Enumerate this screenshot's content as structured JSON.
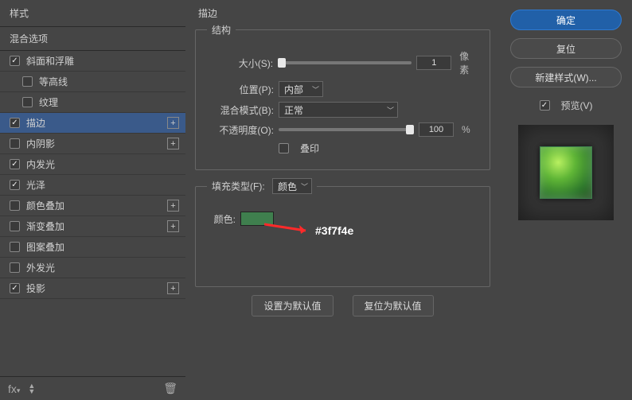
{
  "left": {
    "header": "样式",
    "subheader": "混合选项",
    "items": [
      {
        "label": "斜面和浮雕",
        "checked": true,
        "indented": false,
        "plus": false
      },
      {
        "label": "等高线",
        "checked": false,
        "indented": true,
        "plus": false
      },
      {
        "label": "纹理",
        "checked": false,
        "indented": true,
        "plus": false
      },
      {
        "label": "描边",
        "checked": true,
        "indented": false,
        "plus": true,
        "selected": true
      },
      {
        "label": "内阴影",
        "checked": false,
        "indented": false,
        "plus": true
      },
      {
        "label": "内发光",
        "checked": true,
        "indented": false,
        "plus": false
      },
      {
        "label": "光泽",
        "checked": true,
        "indented": false,
        "plus": false
      },
      {
        "label": "颜色叠加",
        "checked": false,
        "indented": false,
        "plus": true
      },
      {
        "label": "渐变叠加",
        "checked": false,
        "indented": false,
        "plus": true
      },
      {
        "label": "图案叠加",
        "checked": false,
        "indented": false,
        "plus": false
      },
      {
        "label": "外发光",
        "checked": false,
        "indented": false,
        "plus": false
      },
      {
        "label": "投影",
        "checked": true,
        "indented": false,
        "plus": true
      }
    ],
    "footer": {
      "fx": "fx",
      "arrows": "↑↓",
      "trash": "🗑"
    }
  },
  "mid": {
    "title": "描边",
    "structure_legend": "结构",
    "size_label": "大小(S):",
    "size_value": "1",
    "size_unit": "像素",
    "position_label": "位置(P):",
    "position_value": "内部",
    "blend_label": "混合模式(B):",
    "blend_value": "正常",
    "opacity_label": "不透明度(O):",
    "opacity_value": "100",
    "opacity_unit": "%",
    "overprint_label": "叠印",
    "fill_legend": "填充类型(F):",
    "fill_value": "颜色",
    "color_label": "颜色:",
    "color_hex": "#3f7f4e",
    "annotation": "#3f7f4e",
    "btn_default": "设置为默认值",
    "btn_reset": "复位为默认值"
  },
  "right": {
    "ok": "确定",
    "reset": "复位",
    "new_style": "新建样式(W)...",
    "preview_label": "预览(V)",
    "preview_checked": true
  }
}
